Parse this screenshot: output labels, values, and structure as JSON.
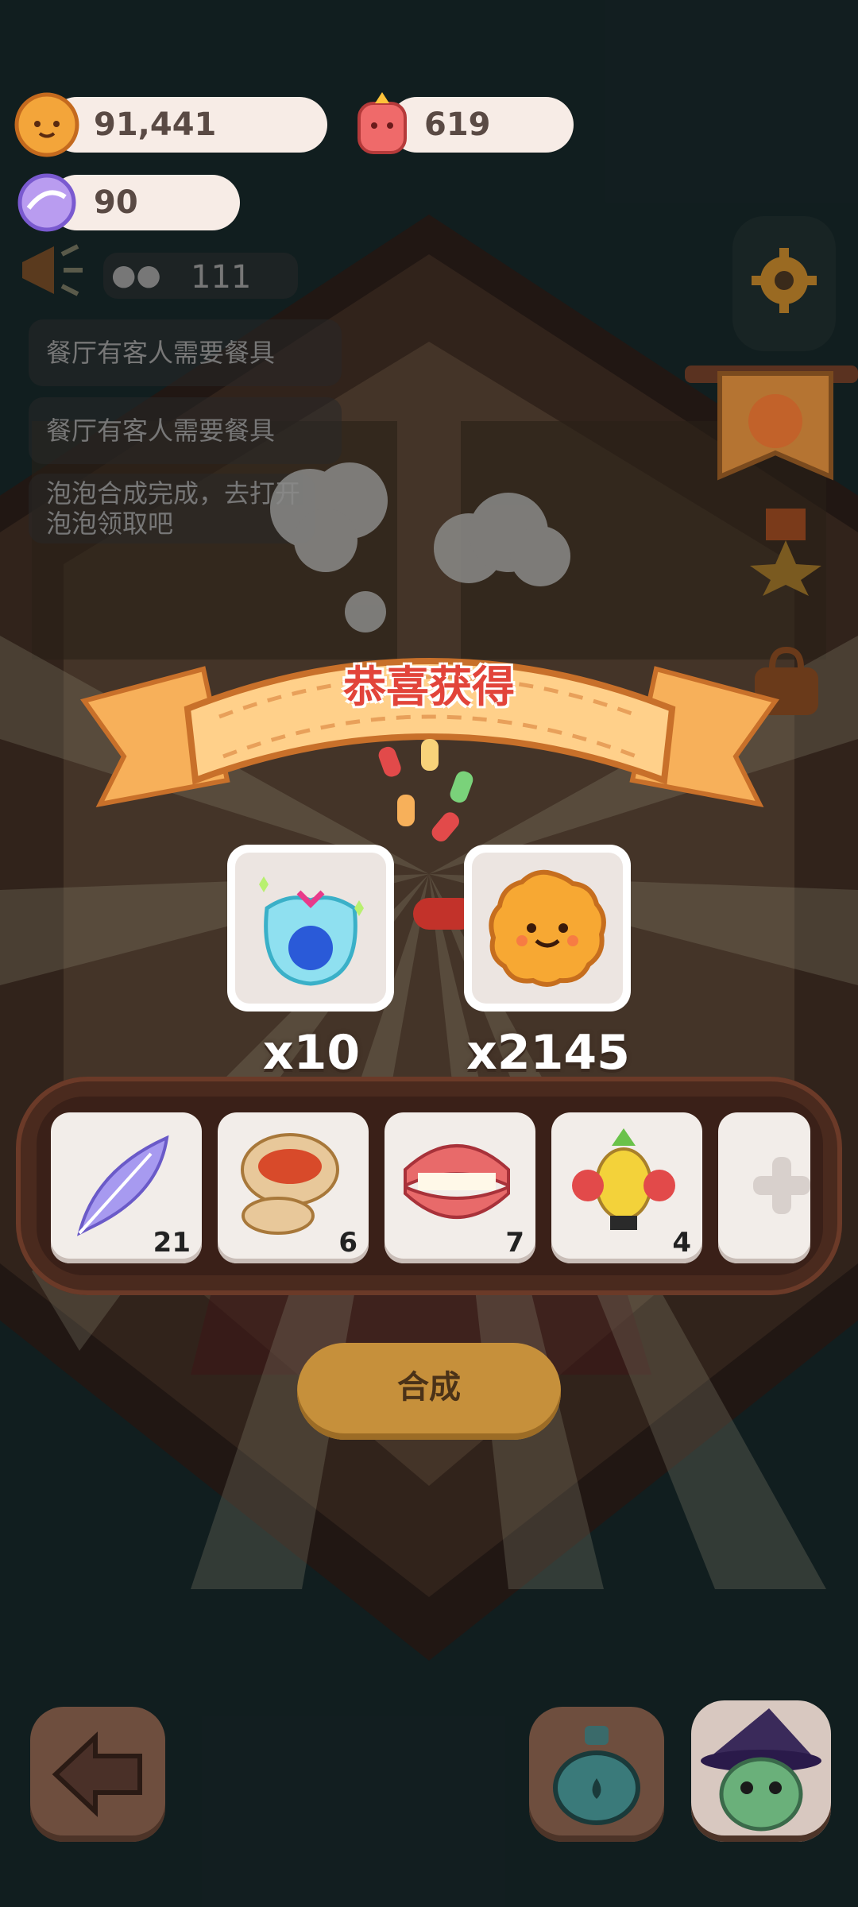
{
  "currencies": {
    "cookies": "91,441",
    "gems": "619",
    "candy": "90"
  },
  "notices": {
    "visitors": "111",
    "messages": [
      "餐厅有客人需要餐具",
      "餐厅有客人需要餐具",
      "泡泡合成完成，去打开",
      "泡泡领取吧"
    ]
  },
  "banner": {
    "title": "恭喜获得"
  },
  "rewards": [
    {
      "icon": "sparkle-bag-icon",
      "qty": "x10"
    },
    {
      "icon": "cookie-icon",
      "qty": "x2145"
    }
  ],
  "tray": {
    "slots": [
      {
        "icon": "feather-icon",
        "count": "21"
      },
      {
        "icon": "dumpling-icon",
        "count": "6"
      },
      {
        "icon": "dentures-icon",
        "count": "7"
      },
      {
        "icon": "pineapple-boxer-icon",
        "count": "4"
      }
    ]
  },
  "actions": {
    "synthesize": "合成"
  },
  "colors": {
    "accent": "#f5a34d",
    "banner": "#ffd08a",
    "button": "#c6903b"
  }
}
